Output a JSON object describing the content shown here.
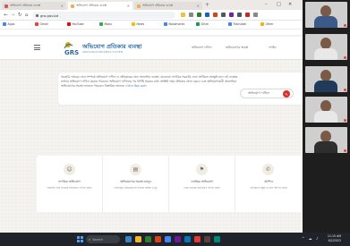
{
  "browser": {
    "tabs": [
      {
        "label": "অভিযোগ প্রতিকার ব্যবস্থা",
        "favicon_color": "#d9534f",
        "active": false
      },
      {
        "label": "অভিযোগ প্রতিকার ব্যবস্থা",
        "favicon_color": "#f0ad4e",
        "active": true
      },
      {
        "label": "অভিযোগ প্রতিকার ব্যবস্থা",
        "favicon_color": "#f0ad4e",
        "active": false
      }
    ],
    "new_tab": "+",
    "window_controls": [
      "–",
      "□",
      "✕"
    ],
    "nav": {
      "back": "←",
      "forward": "→",
      "reload": "↻",
      "home": "⌂"
    },
    "url": "gro.gov.bd",
    "extension_colors": [
      "#f0c040",
      "#888888",
      "#2e7d32",
      "#1565c0",
      "#d84315",
      "#555555",
      "#7b1fa2",
      "#455a64",
      "#c62828",
      "#888888"
    ],
    "bookmarks": [
      {
        "label": "Apps",
        "color": "#4285f4"
      },
      {
        "label": "Gmail",
        "color": "#ea4335"
      },
      {
        "label": "YouTube",
        "color": "#ff0000"
      },
      {
        "label": "Maps",
        "color": "#34a853"
      },
      {
        "label": "News",
        "color": "#fbbc05"
      },
      {
        "label": "Bookmarks",
        "color": "#4285f4"
      },
      {
        "label": "Drive",
        "color": "#0f9d58"
      },
      {
        "label": "Translate",
        "color": "#4285f4"
      },
      {
        "label": "Other",
        "color": "#f4b400"
      }
    ]
  },
  "site": {
    "logo_text": "GRS",
    "title": "অভিযোগ প্রতিকার ব্যবস্থা",
    "subtitle": "GRIEVANCE REDRESS SYSTEM",
    "nav_links": [
      "অভিযোগ দাখিল",
      "অভিযোগের অবস্থা",
      "লগইন"
    ],
    "intro": "সরকারি দপ্তরের সেবা সম্পর্কে অভিযোগ দাখিল ও প্রতিকারের জন্য অনলাইন ব্যবস্থা। যেকোনো নাগরিক সরকারি সেবা প্রাপ্তিতে অসন্তুষ্ট হলে এই ব্যবস্থার মাধ্যমে অভিযোগ দাখিল করতে পারবেন। অভিযোগ দাখিলের পর নির্দিষ্ট সময়ের মধ্যে সংশ্লিষ্ট দপ্তর প্রতিকার প্রদান করবে এবং অভিযোগকারী অনলাইনে অভিযোগের অবস্থা জানতে পারবেন। বিস্তারিত জানতে",
    "intro_link": "এখানে ক্লিক করুন",
    "complaint_button": "অভিযোগ দাখিল",
    "services": [
      {
        "icon": "☺",
        "title": "নাগরিক অভিযোগ",
        "desc": "সরকারি সেবা সংক্রান্ত অভিযোগ দাখিল করুন"
      },
      {
        "icon": "▤",
        "title": "অভিযোগের অবস্থা জানুন",
        "desc": "দাখিলকৃত অভিযোগের বর্তমান অবস্থা দেখুন"
      },
      {
        "icon": "⚑",
        "title": "দাপ্তরিক অভিযোগ",
        "desc": "দপ্তর সংক্রান্ত অভিযোগ দাখিল করুন"
      },
      {
        "icon": "✆",
        "title": "আপিল",
        "desc": "প্রতিকারে সন্তুষ্ট না হলে আপিল করুন"
      }
    ]
  },
  "video": {
    "participants": [
      {
        "name": "",
        "shirt": "#3a5a8a"
      },
      {
        "name": "",
        "shirt": "#e8e8e8"
      },
      {
        "name": "",
        "shirt": "#1f3a5a"
      },
      {
        "name": "",
        "shirt": "#e8e8e8"
      },
      {
        "name": "",
        "shirt": "#2e2e2e"
      }
    ]
  },
  "taskbar": {
    "search_placeholder": "Search",
    "icon_colors": [
      "#3b82c4",
      "#f2b632",
      "#2e7d32",
      "#d84315",
      "#4285f4",
      "#6a1b9a",
      "#0277bd",
      "#e53935",
      "#5d4037",
      "#00897b"
    ],
    "time": "11:15 AM",
    "date": "6/2/2022",
    "tray": "^ ☁ ♪"
  }
}
